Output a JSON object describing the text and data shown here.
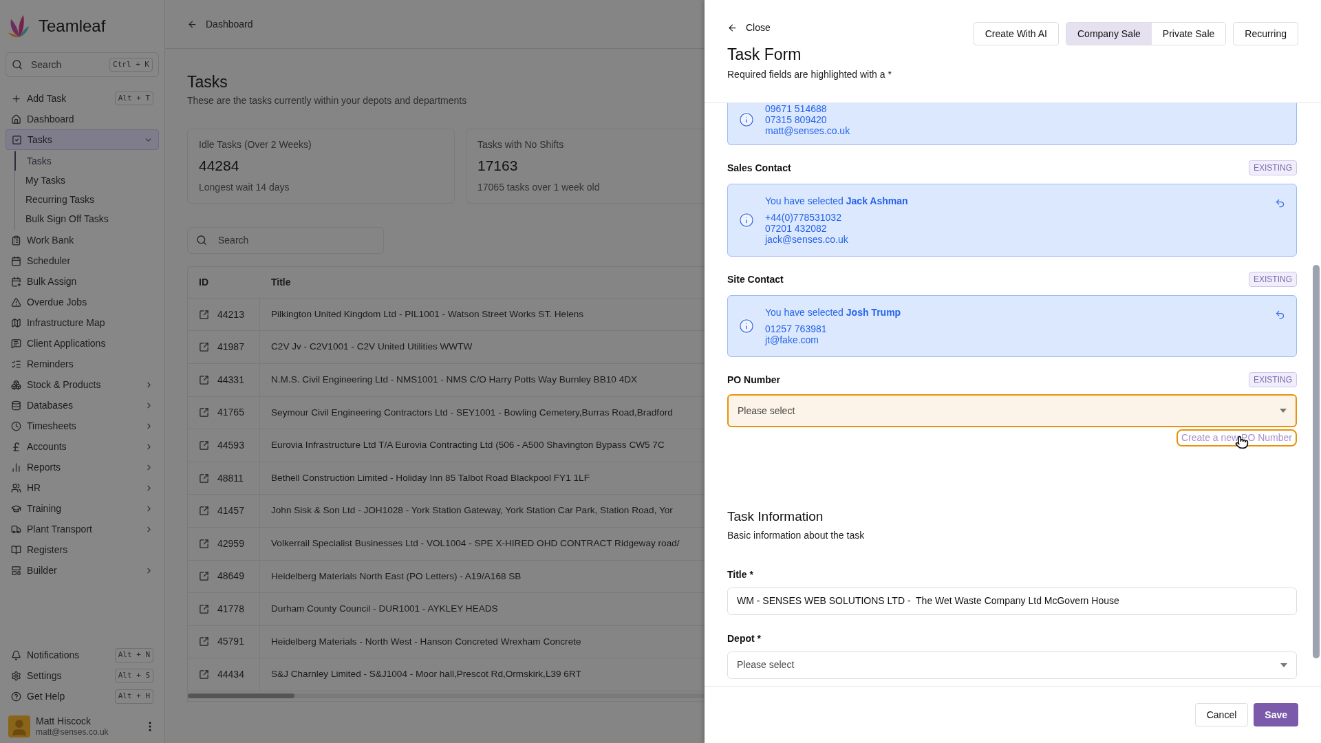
{
  "sidebar": {
    "logo": "Teamleaf",
    "search": {
      "placeholder": "Search",
      "shortcut": "Ctrl + K"
    },
    "items": [
      {
        "label": "Add Task",
        "shortcut": "Alt + T",
        "selected": false
      },
      {
        "label": "Dashboard",
        "selected": false
      },
      {
        "label": "Tasks",
        "expanded": true,
        "selected": true,
        "children": [
          {
            "label": "Tasks",
            "selected": true
          },
          {
            "label": "My Tasks",
            "selected": false
          },
          {
            "label": "Recurring Tasks",
            "selected": false
          },
          {
            "label": "Bulk Sign Off Tasks",
            "selected": false
          }
        ]
      },
      {
        "label": "Work Bank",
        "selected": false
      },
      {
        "label": "Scheduler",
        "selected": false
      },
      {
        "label": "Bulk Assign",
        "selected": false
      },
      {
        "label": "Overdue Jobs",
        "selected": false
      },
      {
        "label": "Infrastructure Map",
        "selected": false
      },
      {
        "label": "Client Applications",
        "selected": false
      },
      {
        "label": "Reminders",
        "selected": false
      },
      {
        "label": "Stock & Products",
        "expanded": false,
        "selected": false
      },
      {
        "label": "Databases",
        "expanded": false,
        "selected": false
      },
      {
        "label": "Timesheets",
        "expanded": false,
        "selected": false
      },
      {
        "label": "Accounts",
        "expanded": false,
        "selected": false
      },
      {
        "label": "Reports",
        "expanded": false,
        "selected": false
      },
      {
        "label": "HR",
        "expanded": false,
        "selected": false
      },
      {
        "label": "Training",
        "expanded": false,
        "selected": false
      },
      {
        "label": "Plant Transport",
        "expanded": false,
        "selected": false
      },
      {
        "label": "Registers",
        "selected": false
      },
      {
        "label": "Builder",
        "expanded": false,
        "selected": false
      }
    ],
    "bottom_items": [
      {
        "label": "Notifications",
        "shortcut": "Alt + N"
      },
      {
        "label": "Settings",
        "shortcut": "Alt + S"
      },
      {
        "label": "Get Help",
        "shortcut": "Alt + H"
      }
    ],
    "user": {
      "name": "Matt Hiscock",
      "email": "matt@senses.co.uk"
    }
  },
  "main": {
    "back_link": "Dashboard",
    "title": "Tasks",
    "subtitle": "These are the tasks currently within your depots and departments",
    "stats": [
      {
        "label": "Idle Tasks (Over 2 Weeks)",
        "value": "44284",
        "note": "Longest wait 14 days"
      },
      {
        "label": "Tasks with No Shifts",
        "value": "17163",
        "note": "17065 tasks over 1 week old"
      }
    ],
    "search": {
      "placeholder": "Search"
    },
    "table": {
      "columns": [
        "ID",
        "Title"
      ],
      "rows": [
        [
          "44213",
          "Pilkington United Kingdom Ltd - PIL1001 - Watson Street Works ST. Helens"
        ],
        [
          "41987",
          "C2V Jv - C2V1001 - C2V United Utilities WWTW"
        ],
        [
          "44331",
          "N.M.S. Civil Engineering Ltd - NMS1001 - NMS C/O Harry Potts Way Burnley BB10 4DX"
        ],
        [
          "41765",
          "Seymour Civil Engineering Contractors Ltd - SEY1001 - Bowling Cemetery,Burras Road,Bradford"
        ],
        [
          "44593",
          "Eurovia Infrastructure Ltd T/A Eurovia Contracting Ltd (506 - A500 Shavington Bypass CW5 7C"
        ],
        [
          "48811",
          "Bethell Construction Limited - Holiday Inn 85 Talbot Road Blackpool FY1 1LF"
        ],
        [
          "41457",
          "John Sisk & Son Ltd - JOH1028 - York Station Gateway, York Station Car Park, Station Road, Yor"
        ],
        [
          "42959",
          "Volkerrail Specialist Businesses Ltd - VOL1004 - SPE X-HIRED OHD CONTRACT Ridgeway road/"
        ],
        [
          "48649",
          "Heidelberg Materials North East (PO Letters) - A19/A168 SB"
        ],
        [
          "41778",
          "Durham County Council - DUR1001 - AYKLEY HEADS"
        ],
        [
          "45791",
          "Heidelberg Materials - North West - Hanson Concreted Wrexham Concrete"
        ],
        [
          "44434",
          "S&J Charnley Limited - S&J1004 - Moor hall,Prescot Rd,Ormskirk,L39 6RT"
        ]
      ]
    }
  },
  "panel": {
    "close": "Close",
    "title": "Task Form",
    "subtitle": "Required fields are highlighted with a *",
    "create_ai_button": "Create With AI",
    "mode_tabs": [
      {
        "label": "Company Sale",
        "selected": true
      },
      {
        "label": "Private Sale",
        "selected": false
      }
    ],
    "recurring_button": "Recurring",
    "contacts": [
      {
        "lines": [
          "09671 514688",
          "07315 809420",
          "matt@senses.co.uk"
        ]
      },
      {
        "label": "Sales Contact",
        "badge": "EXISTING",
        "selected_text": "You have selected **Jack Ashman**",
        "lines": [
          "+44(0)778531032",
          "07201 432082",
          "jack@senses.co.uk"
        ]
      },
      {
        "label": "Site Contact",
        "badge": "EXISTING",
        "selected_text": "You have selected **Josh Trump**",
        "lines": [
          "01257 763981",
          "jt@fake.com"
        ]
      }
    ],
    "po_number": {
      "label": "PO Number",
      "badge": "EXISTING",
      "placeholder": "Please select",
      "focused": true,
      "link": "Create a new PO Number",
      "link_focused": true
    },
    "section": {
      "title": "Task Information",
      "subtitle": "Basic information about the task"
    },
    "fields": [
      {
        "kind": "text",
        "label": "Title *",
        "value": "WM - SENSES WEB SOLUTIONS LTD -  The Wet Waste Company Ltd McGovern House"
      },
      {
        "kind": "select",
        "label": "Depot *",
        "placeholder": "Please select"
      }
    ],
    "footer": {
      "cancel": "Cancel",
      "save": "Save"
    }
  }
}
